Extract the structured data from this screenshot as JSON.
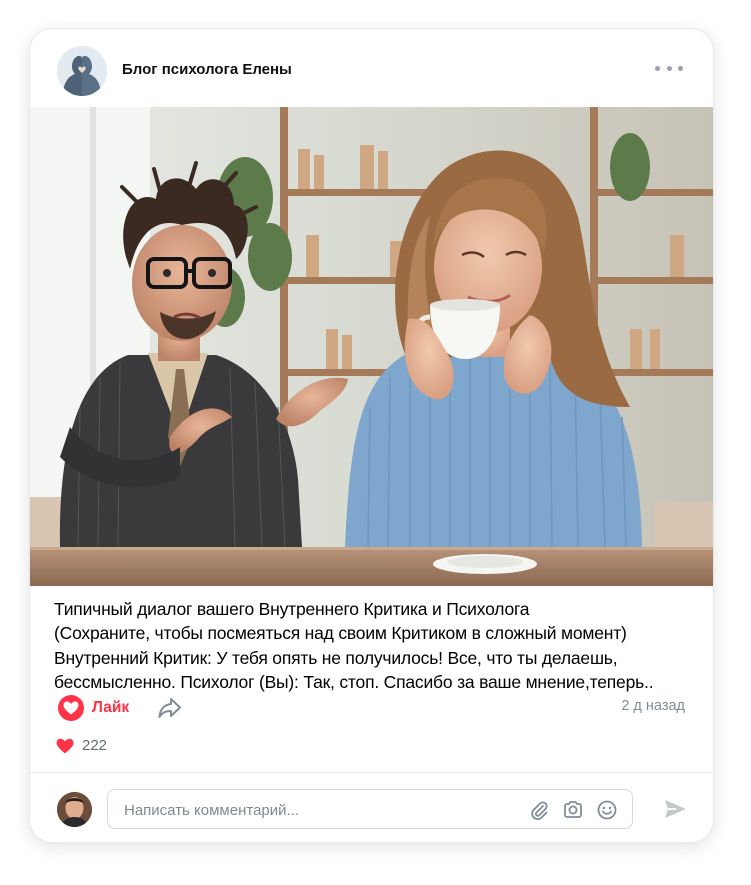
{
  "post": {
    "author": "Блог психолога Елены",
    "image_alt": "Тревожный мужчина в костюме жестикулирует, женщина в голубом свитере спокойно пьёт кофе",
    "lines": [
      "Типичный диалог вашего Внутреннего Критика и Психолога",
      "(Сохраните, чтобы посмеяться над своим Критиком в сложный момент)",
      "Внутренний Критик: У тебя опять не получилось! Все, что ты делаешь,",
      "бессмысленно. Психолог (Вы): Так, стоп. Спасибо за ваше мнение,теперь.."
    ],
    "like_label": "Лайк",
    "time": "2 д назад",
    "likes_count": "222"
  },
  "comment": {
    "placeholder": "Написать комментарий..."
  },
  "icons": [
    "more-icon",
    "heart-icon",
    "share-icon",
    "attach-icon",
    "camera-icon",
    "emoji-icon",
    "send-icon"
  ],
  "colors": {
    "accent_red": "#ff3347",
    "muted": "#818c99",
    "send": "#c4c8cc"
  }
}
